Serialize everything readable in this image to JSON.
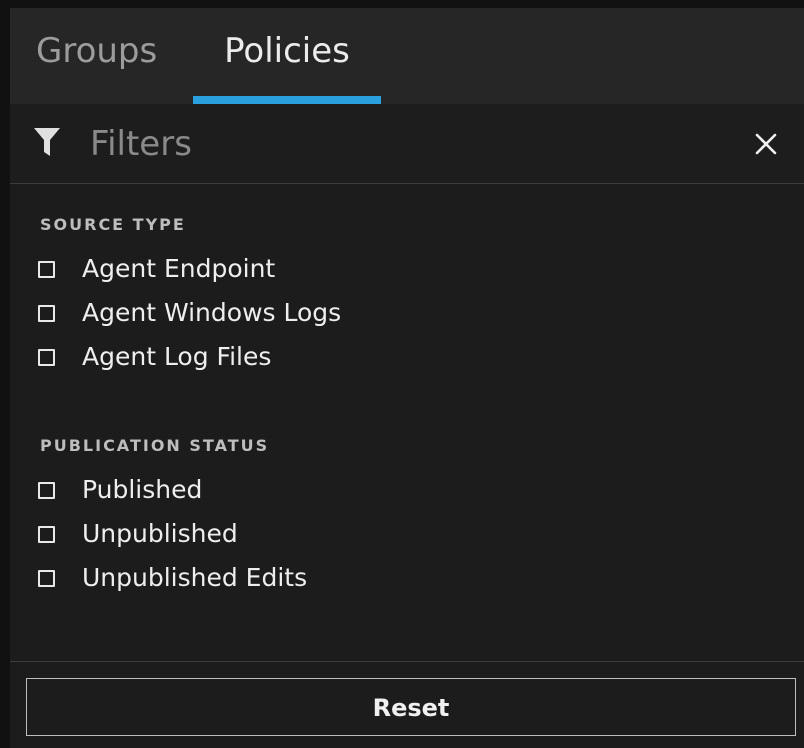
{
  "tabs": {
    "groups_label": "Groups",
    "policies_label": "Policies",
    "active": "Policies"
  },
  "filters": {
    "title": "Filters",
    "icons": {
      "filter": "funnel-icon",
      "close": "close-icon"
    }
  },
  "source_type": {
    "title": "SOURCE TYPE",
    "options": [
      {
        "label": "Agent Endpoint",
        "checked": false
      },
      {
        "label": "Agent Windows Logs",
        "checked": false
      },
      {
        "label": "Agent Log Files",
        "checked": false
      }
    ]
  },
  "publication_status": {
    "title": "PUBLICATION STATUS",
    "options": [
      {
        "label": "Published",
        "checked": false
      },
      {
        "label": "Unpublished",
        "checked": false
      },
      {
        "label": "Unpublished Edits",
        "checked": false
      }
    ]
  },
  "footer": {
    "reset_label": "Reset"
  },
  "colors": {
    "accent": "#2aa0de",
    "background": "#1c1c1c",
    "tab_bar": "#262626"
  }
}
